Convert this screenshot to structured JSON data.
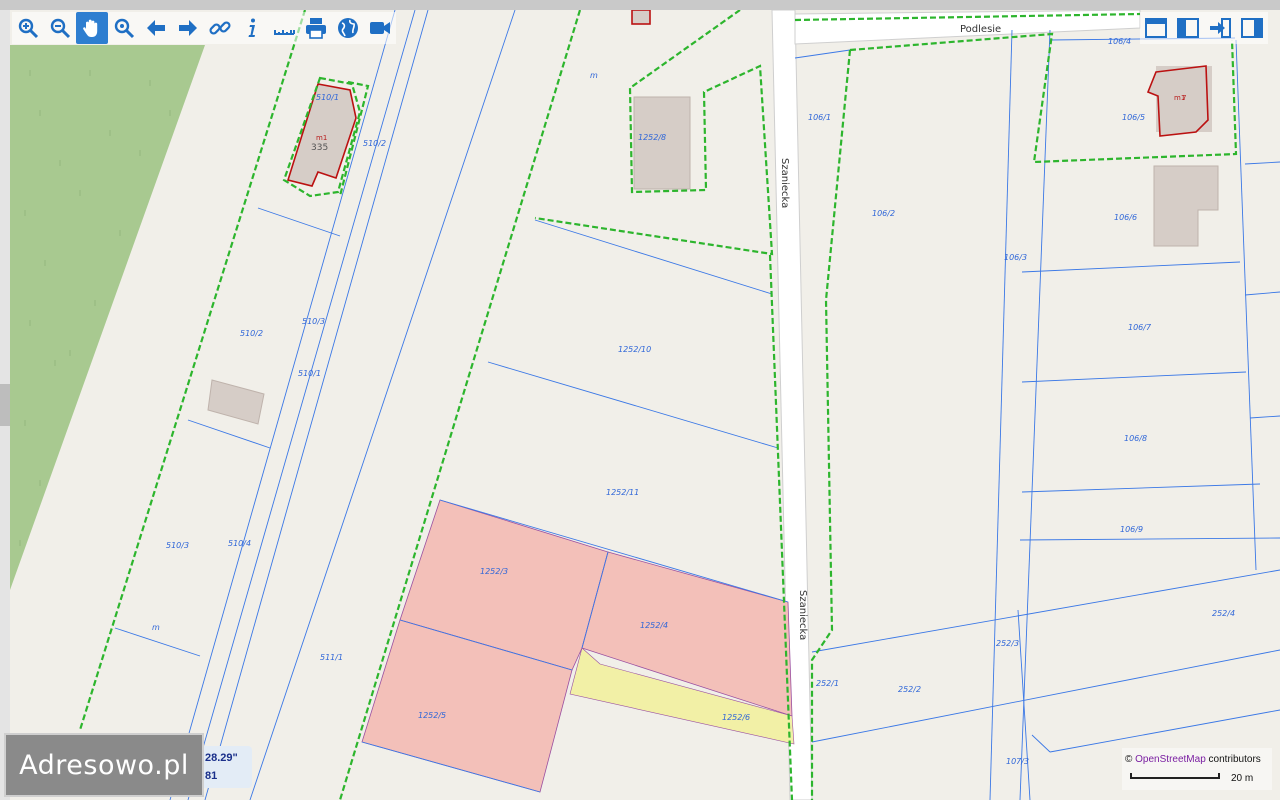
{
  "toolbar": [
    {
      "name": "zoom-in-icon",
      "title": "Zoom in"
    },
    {
      "name": "zoom-out-icon",
      "title": "Zoom out"
    },
    {
      "name": "pan-hand-icon",
      "title": "Pan",
      "active": true
    },
    {
      "name": "zoom-box-icon",
      "title": "Zoom to area"
    },
    {
      "name": "arrow-left-icon",
      "title": "Previous view"
    },
    {
      "name": "arrow-right-icon",
      "title": "Next view"
    },
    {
      "name": "link-icon",
      "title": "Link"
    },
    {
      "name": "info-icon",
      "title": "Info"
    },
    {
      "name": "ruler-icon",
      "title": "Measure"
    },
    {
      "name": "print-icon",
      "title": "Print"
    },
    {
      "name": "globe-icon",
      "title": "Layers"
    },
    {
      "name": "camera-icon",
      "title": "Street view"
    }
  ],
  "right_toolbar": [
    {
      "name": "window-icon"
    },
    {
      "name": "split-left-icon"
    },
    {
      "name": "exit-icon"
    },
    {
      "name": "split-right-icon"
    }
  ],
  "streets": {
    "podlesie": "Podlesie",
    "szaniecka_upper": "Szaniecka",
    "szaniecka_lower": "Szaniecka"
  },
  "parcels": {
    "p510_1": "510/1",
    "p510_2_top": "510/2",
    "p510_3_mid": "510/3",
    "p510_2_left": "510/2",
    "p510_x": "510/1",
    "p510_3_left": "510/3",
    "p510_4": "510/4",
    "p511_1": "511/1",
    "m_left": "m",
    "p1252_8": "1252/8",
    "p1252_10": "1252/10",
    "p1252_11": "1252/11",
    "p1252_3": "1252/3",
    "p1252_4": "1252/4",
    "p1252_5": "1252/5",
    "p1252_6": "1252/6",
    "m_top": "m",
    "p106_4": "106/4",
    "p106_1": "106/1",
    "p106_5": "106/5",
    "p106_2": "106/2",
    "p106_6": "106/6",
    "p106_3": "106/3",
    "p106_7": "106/7",
    "p106_8": "106/8",
    "p106_9": "106/9",
    "p252_4": "252/4",
    "p252_3": "252/3",
    "p252_2": "252/2",
    "p252_1": "252/1",
    "p107_3": "107/3"
  },
  "buildings": {
    "m1_left": "m1",
    "num_left": "335",
    "m1_right": "m1",
    "num_right": "7"
  },
  "logo": "Adresowo.pl",
  "coords": {
    "line1": "28.29\"",
    "line2": "81"
  },
  "attribution": {
    "prefix": "©",
    "osm": "OpenStreetMap",
    "suffix": "contributors"
  },
  "scale": "20 m",
  "colors": {
    "background": "#f1efe9",
    "forest": "#a8c990",
    "parcel_line": "#3b78e6",
    "boundary": "#2db52d",
    "highlight": "#f3c0b9",
    "yellow": "#f2f0a6",
    "building": "#d6cdc7",
    "toolbar_active": "#2e7ed0"
  }
}
